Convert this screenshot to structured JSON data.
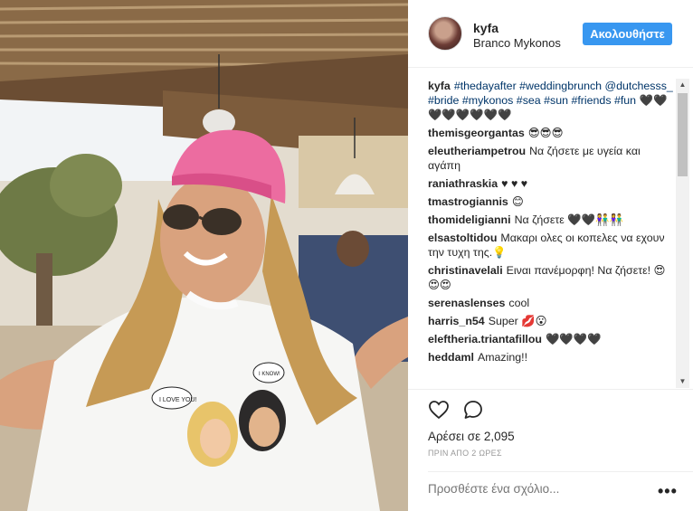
{
  "post": {
    "username": "kyfa",
    "location": "Branco Mykonos",
    "follow_label": "Ακολουθήστε",
    "caption_user": "kyfa",
    "caption": [
      "#thedayafter #weddingbrunch",
      "@dutchesss_ #bride #mykonos #sea #sun",
      "#friends #fun 🖤🖤🖤🖤🖤🖤🖤🖤"
    ],
    "likes": "Αρέσει σε 2,095",
    "time_ago": "ΠΡΙΝ ΑΠΟ 2 ΩΡΕΣ",
    "add_comment_placeholder": "Προσθέστε ένα σχόλιο...",
    "more_options": "•••"
  },
  "comments": [
    {
      "user": "themisgeorgantas",
      "text": "😎😎😎"
    },
    {
      "user": "eleutheriampetrou",
      "text": "Να ζήσετε με υγεία και αγάπη"
    },
    {
      "user": "raniathraskia",
      "text": "♥ ♥ ♥"
    },
    {
      "user": "tmastrogiannis",
      "text": "😊"
    },
    {
      "user": "thomideligianni",
      "text": "Να ζήσετε 🖤🖤👫👫"
    },
    {
      "user": "elsastoltidou",
      "text": "Μακαρι ολες οι κοπελες να εχουν την τυχη της.💡"
    },
    {
      "user": "christinavelali",
      "text": "Ειναι πανέμορφη! Να ζήσετε! 😍😍😍"
    },
    {
      "user": "serenaslenses",
      "text": "cool"
    },
    {
      "user": "harris_n54",
      "text": "Super 💋😮"
    },
    {
      "user": "eleftheria.triantafillou",
      "text": "🖤🖤🖤🖤"
    },
    {
      "user": "heddaml",
      "text": "Amazing!!"
    }
  ],
  "icons": {
    "heart": "heart-icon",
    "comment": "comment-bubble-icon",
    "more": "more-options-icon"
  },
  "colors": {
    "follow_button": "#3897f0",
    "hashtag": "#003569",
    "muted": "#999999"
  }
}
